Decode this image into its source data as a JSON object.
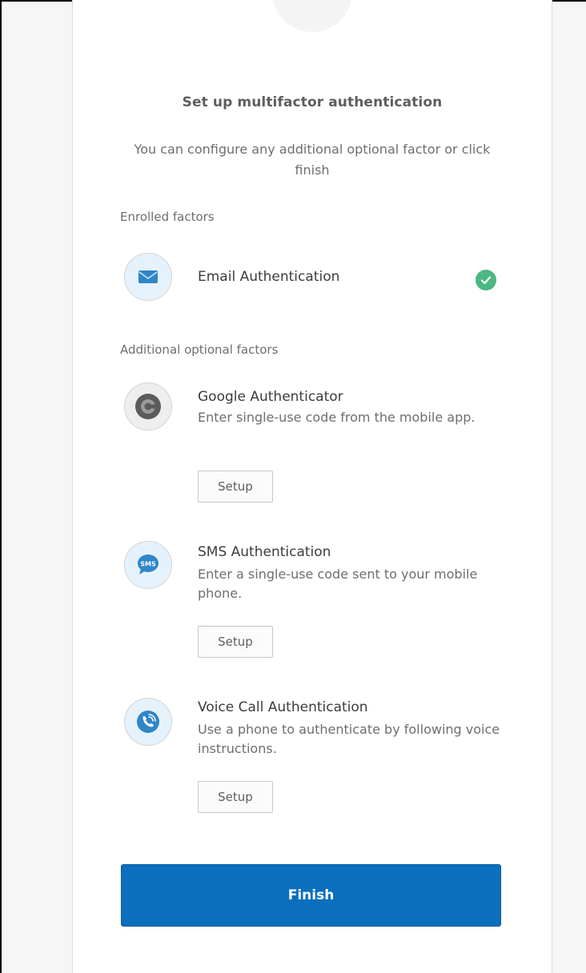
{
  "title": "Set up multifactor authentication",
  "subtitle": "You can configure any additional optional factor or click finish",
  "enrolled_label": "Enrolled factors",
  "enrolled": {
    "name": "Email Authentication",
    "icon": "email-icon",
    "status_icon": "check-circle-icon"
  },
  "optional_label": "Additional optional factors",
  "factors": [
    {
      "name": "Google Authenticator",
      "description": "Enter single-use code from the mobile app.",
      "icon": "google-authenticator-icon",
      "button": "Setup"
    },
    {
      "name": "SMS Authentication",
      "description": "Enter a single-use code sent to your mobile phone.",
      "icon": "sms-icon",
      "button": "Setup"
    },
    {
      "name": "Voice Call Authentication",
      "description": "Use a phone to authenticate by following voice instructions.",
      "icon": "phone-call-icon",
      "button": "Setup"
    }
  ],
  "finish_label": "Finish",
  "colors": {
    "primary": "#0b6fbe",
    "success": "#4cb781",
    "icon_blue": "#2f86c9"
  }
}
